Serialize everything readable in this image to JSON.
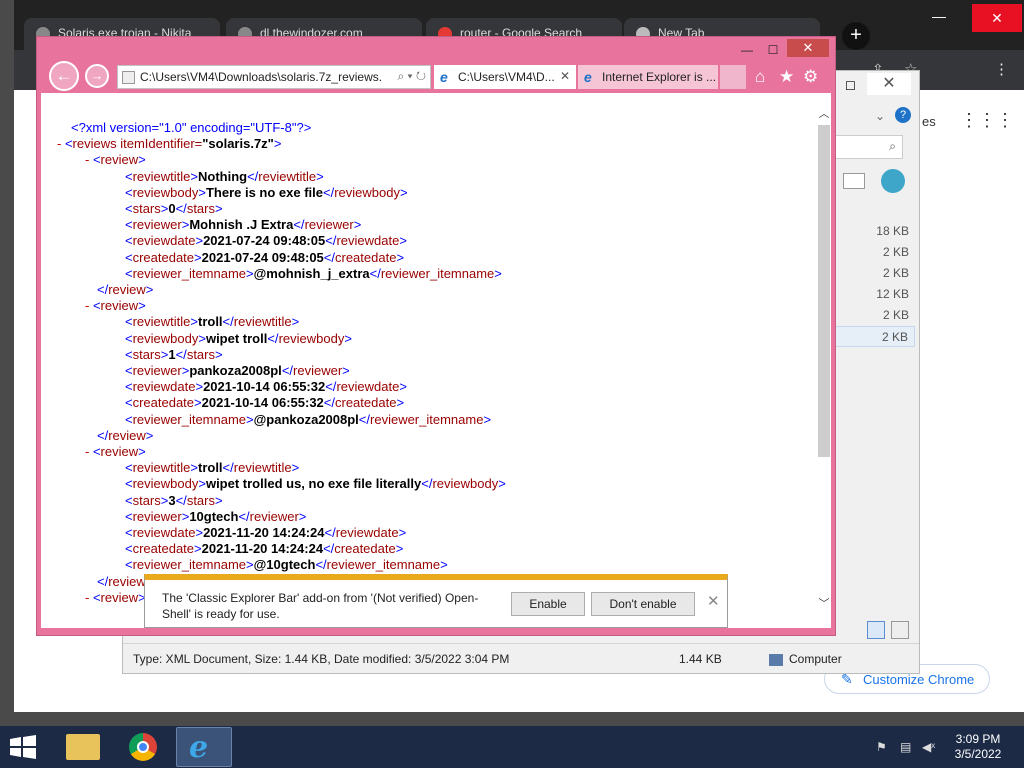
{
  "chrome": {
    "tabs": [
      "Solaris.exe trojan - Nikita",
      "dl.thewindozer.com",
      "router - Google Search",
      "New Tab"
    ],
    "customize_label": "Customize Chrome",
    "partial_text": "es"
  },
  "explorer": {
    "sizes": [
      "18 KB",
      "2 KB",
      "2 KB",
      "12 KB",
      "2 KB",
      "2 KB"
    ],
    "status_text": "Type: XML Document, Size: 1.44 KB, Date modified: 3/5/2022 3:04 PM",
    "status_size": "1.44 KB",
    "status_location": "Computer"
  },
  "ie": {
    "address": "C:\\Users\\VM4\\Downloads\\solaris.7z_reviews.",
    "tabs": [
      {
        "label": "C:\\Users\\VM4\\D..."
      },
      {
        "label": "Internet Explorer is ..."
      }
    ],
    "xml_declaration": "<?xml version=\"1.0\" encoding=\"UTF-8\"?>",
    "root_open": "reviews itemIdentifier=",
    "root_value": "\"solaris.7z\"",
    "reviews": [
      {
        "reviewtitle": "Nothing",
        "reviewbody": "There is no exe file",
        "stars": "0",
        "reviewer": "Mohnish .J Extra",
        "reviewdate": "2021-07-24 09:48:05",
        "createdate": "2021-07-24 09:48:05",
        "reviewer_itemname": "@mohnish_j_extra"
      },
      {
        "reviewtitle": "troll",
        "reviewbody": "wipet troll",
        "stars": "1",
        "reviewer": "pankoza2008pl",
        "reviewdate": "2021-10-14 06:55:32",
        "createdate": "2021-10-14 06:55:32",
        "reviewer_itemname": "@pankoza2008pl"
      },
      {
        "reviewtitle": "troll",
        "reviewbody": "wipet trolled us, no exe file literally",
        "stars": "3",
        "reviewer": "10gtech",
        "reviewdate": "2021-11-20 14:24:24",
        "createdate": "2021-11-20 14:24:24",
        "reviewer_itemname": "@10gtech"
      }
    ]
  },
  "notification": {
    "message": "The 'Classic Explorer Bar' add-on from '(Not verified) Open-Shell' is ready for use.",
    "enable_label": "Enable",
    "dont_enable_label": "Don't enable"
  },
  "taskbar": {
    "time": "3:09 PM",
    "date": "3/5/2022"
  }
}
